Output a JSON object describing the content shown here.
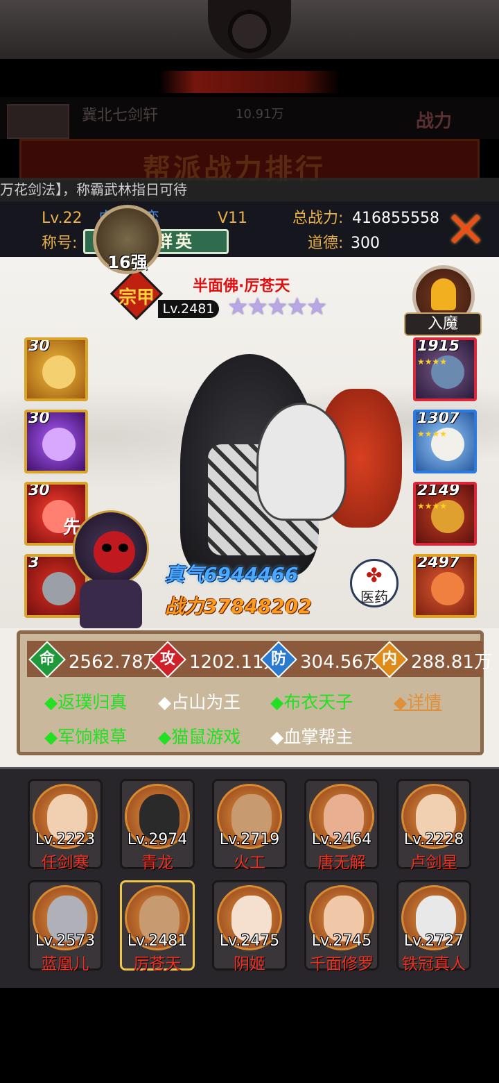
{
  "background": {
    "guild_name": "冀北七剑轩",
    "guild_value": "10.91万",
    "side_button": "战力",
    "banner_title": "帮派战力排行"
  },
  "marquee_text": "万花剑法】，称霸武林指日可待",
  "player": {
    "level": "Lv.22",
    "name": "虐心苦恋",
    "vip": "V11",
    "total_power_label": "总战力:",
    "total_power": "416855558",
    "title_label": "称号:",
    "title_badge": "江湖群英",
    "morality_label": "道德:",
    "morality": "300"
  },
  "hero": {
    "rank_mark": "宗甲",
    "name": "半面佛·厉苍天",
    "level": "Lv.2481",
    "stars": "★★★★★",
    "star_count": 5,
    "rumo_label": "入魔",
    "strengthen": "16强",
    "zhenqi": "真气6944466",
    "zhanli": "战力37848202",
    "yiyao_label": "医药"
  },
  "left_slots": [
    {
      "num": "30",
      "extra": ""
    },
    {
      "num": "30",
      "extra": ""
    },
    {
      "num": "30",
      "extra": "先"
    },
    {
      "num": "3",
      "extra": ""
    }
  ],
  "right_slots": [
    {
      "num": "1915"
    },
    {
      "num": "1307"
    },
    {
      "num": "2149"
    },
    {
      "num": "2497"
    }
  ],
  "stats": [
    {
      "icon": "命",
      "value": "2562.78万",
      "color": "#1e9a3a"
    },
    {
      "icon": "攻",
      "value": "1202.11万",
      "color": "#d0202a"
    },
    {
      "icon": "防",
      "value": "304.56万",
      "color": "#2a7ad0"
    },
    {
      "icon": "内",
      "value": "288.81万",
      "color": "#e08a1a"
    }
  ],
  "skills": [
    {
      "text": "◆返璞归真",
      "color": "#22e022"
    },
    {
      "text": "◆占山为王",
      "color": "#ffffff"
    },
    {
      "text": "◆布衣天子",
      "color": "#22e022"
    },
    {
      "text": "◆军饷粮草",
      "color": "#22e022"
    },
    {
      "text": "◆猫鼠游戏",
      "color": "#22e022"
    },
    {
      "text": "◆血掌帮主",
      "color": "#ffffff"
    }
  ],
  "detail_link": "◆详情",
  "team": [
    {
      "level": "Lv.2223",
      "name": "任剑寒"
    },
    {
      "level": "Lv.2974",
      "name": "青龙"
    },
    {
      "level": "Lv.2719",
      "name": "火工"
    },
    {
      "level": "Lv.2464",
      "name": "唐无解"
    },
    {
      "level": "Lv.2228",
      "name": "卢剑星"
    },
    {
      "level": "Lv.2573",
      "name": "蓝凰儿"
    },
    {
      "level": "Lv.2481",
      "name": "厉苍天"
    },
    {
      "level": "Lv.2475",
      "name": "阴姬"
    },
    {
      "level": "Lv.2745",
      "name": "千面修罗"
    },
    {
      "level": "Lv.2727",
      "name": "铁冠真人"
    }
  ],
  "selected_team_index": 6
}
